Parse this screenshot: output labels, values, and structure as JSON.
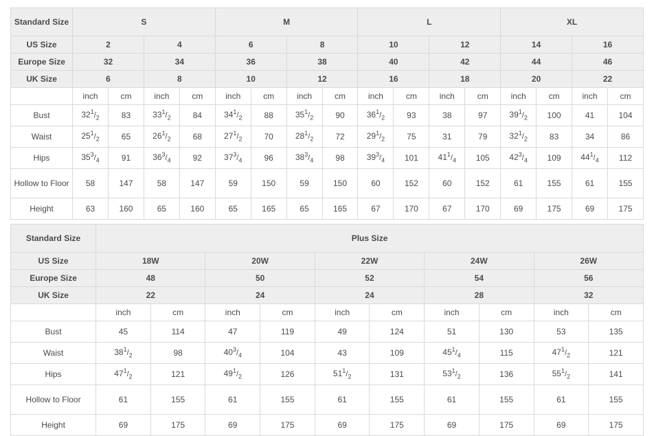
{
  "tables": [
    {
      "name": "standard-size-table",
      "label_header": "Standard Size",
      "groups": [
        {
          "label": "S",
          "span": 4
        },
        {
          "label": "M",
          "span": 4
        },
        {
          "label": "L",
          "span": 4
        },
        {
          "label": "XL",
          "span": 4
        }
      ],
      "size_rows": [
        {
          "label": "US Size",
          "values": [
            "2",
            "4",
            "6",
            "8",
            "10",
            "12",
            "14",
            "16"
          ]
        },
        {
          "label": "Europe Size",
          "values": [
            "32",
            "34",
            "36",
            "38",
            "40",
            "42",
            "44",
            "46"
          ]
        },
        {
          "label": "UK Size",
          "values": [
            "6",
            "8",
            "10",
            "12",
            "16",
            "18",
            "20",
            "22"
          ]
        }
      ],
      "unit_row": [
        "inch",
        "cm",
        "inch",
        "cm",
        "inch",
        "cm",
        "inch",
        "cm",
        "inch",
        "cm",
        "inch",
        "cm",
        "inch",
        "cm",
        "inch",
        "cm"
      ],
      "data_rows": [
        {
          "label": "Bust",
          "tall": false,
          "values": [
            {
              "whole": "32",
              "num": "1",
              "den": "2"
            },
            {
              "whole": "83"
            },
            {
              "whole": "33",
              "num": "1",
              "den": "2"
            },
            {
              "whole": "84"
            },
            {
              "whole": "34",
              "num": "1",
              "den": "2"
            },
            {
              "whole": "88"
            },
            {
              "whole": "35",
              "num": "1",
              "den": "2"
            },
            {
              "whole": "90"
            },
            {
              "whole": "36",
              "num": "1",
              "den": "2"
            },
            {
              "whole": "93"
            },
            {
              "whole": "38"
            },
            {
              "whole": "97"
            },
            {
              "whole": "39",
              "num": "1",
              "den": "2"
            },
            {
              "whole": "100"
            },
            {
              "whole": "41"
            },
            {
              "whole": "104"
            }
          ]
        },
        {
          "label": "Waist",
          "tall": false,
          "values": [
            {
              "whole": "25",
              "num": "1",
              "den": "2"
            },
            {
              "whole": "65"
            },
            {
              "whole": "26",
              "num": "1",
              "den": "2"
            },
            {
              "whole": "68"
            },
            {
              "whole": "27",
              "num": "1",
              "den": "2"
            },
            {
              "whole": "70"
            },
            {
              "whole": "28",
              "num": "1",
              "den": "2"
            },
            {
              "whole": "72"
            },
            {
              "whole": "29",
              "num": "1",
              "den": "2"
            },
            {
              "whole": "75"
            },
            {
              "whole": "31"
            },
            {
              "whole": "79"
            },
            {
              "whole": "32",
              "num": "1",
              "den": "2"
            },
            {
              "whole": "83"
            },
            {
              "whole": "34"
            },
            {
              "whole": "86"
            }
          ]
        },
        {
          "label": "Hips",
          "tall": false,
          "values": [
            {
              "whole": "35",
              "num": "3",
              "den": "4"
            },
            {
              "whole": "91"
            },
            {
              "whole": "36",
              "num": "3",
              "den": "4"
            },
            {
              "whole": "92"
            },
            {
              "whole": "37",
              "num": "3",
              "den": "4"
            },
            {
              "whole": "96"
            },
            {
              "whole": "38",
              "num": "3",
              "den": "4"
            },
            {
              "whole": "98"
            },
            {
              "whole": "39",
              "num": "3",
              "den": "4"
            },
            {
              "whole": "101"
            },
            {
              "whole": "41",
              "num": "1",
              "den": "4"
            },
            {
              "whole": "105"
            },
            {
              "whole": "42",
              "num": "3",
              "den": "4"
            },
            {
              "whole": "109"
            },
            {
              "whole": "44",
              "num": "1",
              "den": "4"
            },
            {
              "whole": "112"
            }
          ]
        },
        {
          "label": "Hollow to Floor",
          "tall": true,
          "values": [
            {
              "whole": "58"
            },
            {
              "whole": "147"
            },
            {
              "whole": "58"
            },
            {
              "whole": "147"
            },
            {
              "whole": "59"
            },
            {
              "whole": "150"
            },
            {
              "whole": "59"
            },
            {
              "whole": "150"
            },
            {
              "whole": "60"
            },
            {
              "whole": "152"
            },
            {
              "whole": "60"
            },
            {
              "whole": "152"
            },
            {
              "whole": "61"
            },
            {
              "whole": "155"
            },
            {
              "whole": "61"
            },
            {
              "whole": "155"
            }
          ]
        },
        {
          "label": "Height",
          "tall": false,
          "values": [
            {
              "whole": "63"
            },
            {
              "whole": "160"
            },
            {
              "whole": "65"
            },
            {
              "whole": "160"
            },
            {
              "whole": "65"
            },
            {
              "whole": "165"
            },
            {
              "whole": "65"
            },
            {
              "whole": "165"
            },
            {
              "whole": "67"
            },
            {
              "whole": "170"
            },
            {
              "whole": "67"
            },
            {
              "whole": "170"
            },
            {
              "whole": "69"
            },
            {
              "whole": "175"
            },
            {
              "whole": "69"
            },
            {
              "whole": "175"
            }
          ]
        }
      ]
    },
    {
      "name": "plus-size-table",
      "label_header": "Standard Size",
      "groups": [
        {
          "label": "Plus Size",
          "span": 10
        }
      ],
      "size_rows": [
        {
          "label": "US Size",
          "values": [
            "18W",
            "20W",
            "22W",
            "24W",
            "26W"
          ]
        },
        {
          "label": "Europe Size",
          "values": [
            "48",
            "50",
            "52",
            "54",
            "56"
          ]
        },
        {
          "label": "UK Size",
          "values": [
            "22",
            "24",
            "24",
            "28",
            "32"
          ]
        }
      ],
      "unit_row": [
        "inch",
        "cm",
        "inch",
        "cm",
        "inch",
        "cm",
        "inch",
        "cm",
        "inch",
        "cm"
      ],
      "data_rows": [
        {
          "label": "Bust",
          "tall": false,
          "values": [
            {
              "whole": "45"
            },
            {
              "whole": "114"
            },
            {
              "whole": "47"
            },
            {
              "whole": "119"
            },
            {
              "whole": "49"
            },
            {
              "whole": "124"
            },
            {
              "whole": "51"
            },
            {
              "whole": "130"
            },
            {
              "whole": "53"
            },
            {
              "whole": "135"
            }
          ]
        },
        {
          "label": "Waist",
          "tall": false,
          "values": [
            {
              "whole": "38",
              "num": "1",
              "den": "2"
            },
            {
              "whole": "98"
            },
            {
              "whole": "40",
              "num": "3",
              "den": "4"
            },
            {
              "whole": "104"
            },
            {
              "whole": "43"
            },
            {
              "whole": "109"
            },
            {
              "whole": "45",
              "num": "1",
              "den": "4"
            },
            {
              "whole": "115"
            },
            {
              "whole": "47",
              "num": "1",
              "den": "2"
            },
            {
              "whole": "121"
            }
          ]
        },
        {
          "label": "Hips",
          "tall": false,
          "values": [
            {
              "whole": "47",
              "num": "1",
              "den": "2"
            },
            {
              "whole": "121"
            },
            {
              "whole": "49",
              "num": "1",
              "den": "2"
            },
            {
              "whole": "126"
            },
            {
              "whole": "51",
              "num": "1",
              "den": "2"
            },
            {
              "whole": "131"
            },
            {
              "whole": "53",
              "num": "1",
              "den": "2"
            },
            {
              "whole": "136"
            },
            {
              "whole": "55",
              "num": "1",
              "den": "2"
            },
            {
              "whole": "141"
            }
          ]
        },
        {
          "label": "Hollow to Floor",
          "tall": true,
          "values": [
            {
              "whole": "61"
            },
            {
              "whole": "155"
            },
            {
              "whole": "61"
            },
            {
              "whole": "155"
            },
            {
              "whole": "61"
            },
            {
              "whole": "155"
            },
            {
              "whole": "61"
            },
            {
              "whole": "155"
            },
            {
              "whole": "61"
            },
            {
              "whole": "155"
            }
          ]
        },
        {
          "label": "Height",
          "tall": false,
          "values": [
            {
              "whole": "69"
            },
            {
              "whole": "175"
            },
            {
              "whole": "69"
            },
            {
              "whole": "175"
            },
            {
              "whole": "69"
            },
            {
              "whole": "175"
            },
            {
              "whole": "69"
            },
            {
              "whole": "175"
            },
            {
              "whole": "69"
            },
            {
              "whole": "175"
            }
          ]
        }
      ]
    }
  ],
  "colors": {
    "header_bg": "#eeeeee",
    "cell_bg": "#ffffff",
    "border": "#d9d9d9",
    "header_text": "#222222",
    "value_text": "#6a6a6a",
    "unit_text": "#9b9b9b"
  }
}
